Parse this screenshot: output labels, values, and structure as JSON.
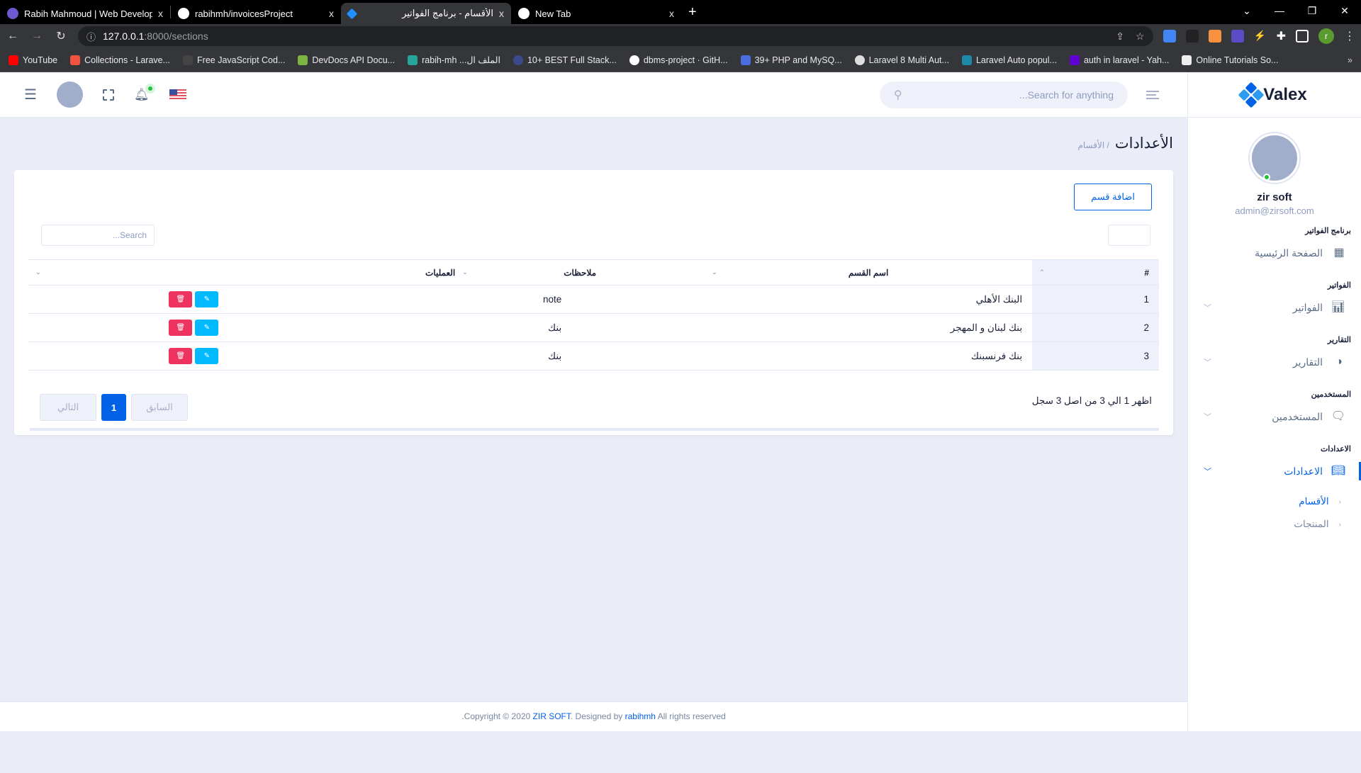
{
  "browser": {
    "tabs": [
      {
        "title": "Rabih Mahmoud | Web Develope",
        "icon": "portfolio-favicon",
        "color": "#6a5acd",
        "active": false
      },
      {
        "title": "rabihmh/invoicesProject",
        "icon": "github-icon",
        "color": "#ffffff",
        "active": false
      },
      {
        "title": "الأقسام - برنامج الفواتير",
        "icon": "valex-favicon",
        "color": "#1e90ff",
        "active": true
      },
      {
        "title": "New Tab",
        "icon": "chrome-icon",
        "color": "#ffffff",
        "active": false
      }
    ],
    "close_glyph": "x",
    "new_tab_glyph": "+",
    "window_controls": {
      "tabsearch": "⌄",
      "minimize": "—",
      "maximize": "❐",
      "close": "✕"
    },
    "url": {
      "host": "127.0.0.1",
      "path": ":8000/sections"
    },
    "profile_initial": "r",
    "bookmarks": [
      {
        "label": "YouTube",
        "color": "#ff0000"
      },
      {
        "label": "Collections - Larave...",
        "color": "#f05340"
      },
      {
        "label": "Free JavaScript Cod...",
        "color": "#444444"
      },
      {
        "label": "DevDocs API Docu...",
        "color": "#7cb342"
      },
      {
        "label": "rabih-mh ...الملف ال",
        "color": "#26a69a"
      },
      {
        "label": "10+ BEST Full Stack...",
        "color": "#3b4a8c"
      },
      {
        "label": "dbms-project · GitH...",
        "color": "#ffffff"
      },
      {
        "label": "39+ PHP and MySQ...",
        "color": "#4a6ee0"
      },
      {
        "label": "Laravel 8 Multi Aut...",
        "color": "#dddddd"
      },
      {
        "label": "Laravel Auto popul...",
        "color": "#1e88a8"
      },
      {
        "label": "auth in laravel - Yah...",
        "color": "#6001d2"
      },
      {
        "label": "Online Tutorials So...",
        "color": "#eeeeee"
      }
    ],
    "bookmarks_more": "»"
  },
  "header": {
    "search_placeholder": "Search for anything...",
    "notification_dot_color": "#22c03c"
  },
  "sidebar": {
    "brand": "Valex",
    "user_name": "zir soft",
    "user_email": "admin@zirsoft.com",
    "sections": [
      {
        "category": "برنامج الفواتير",
        "item": "الصفحة الرئيسية",
        "icon": "dashboard-icon",
        "active": false,
        "has_chevron": false
      },
      {
        "category": "الفواتير",
        "item": "الفواتير",
        "icon": "bar-chart-icon",
        "active": false,
        "has_chevron": true
      },
      {
        "category": "التقارير",
        "item": "التقارير",
        "icon": "pie-chart-icon",
        "active": false,
        "has_chevron": true
      },
      {
        "category": "المستخدمين",
        "item": "المستخدمين",
        "icon": "chat-icon",
        "active": false,
        "has_chevron": true
      },
      {
        "category": "الاعدادات",
        "item": "الاعدادات",
        "icon": "book-icon",
        "active": true,
        "has_chevron": true
      }
    ],
    "sub_items": [
      {
        "label": "الأقسام",
        "active": true
      },
      {
        "label": "المنتجات",
        "active": false
      }
    ],
    "accent_color": "#0162e8"
  },
  "page": {
    "title": "الأعدادات",
    "breadcrumb_sub": "/ الأقسام",
    "add_button": "اضافة قسم",
    "table_search_placeholder": "Search...",
    "columns": [
      "#",
      "اسم القسم",
      "ملاحظات",
      "العمليات"
    ],
    "rows": [
      {
        "num": "1",
        "name": "البنك الأهلي",
        "notes": "note"
      },
      {
        "num": "2",
        "name": "بنك لبنان و المهجر",
        "notes": "بنك"
      },
      {
        "num": "3",
        "name": "بنك فرنسبنك",
        "notes": "بنك"
      }
    ],
    "info_text": "اظهر 1 الي 3 من اصل 3 سجل",
    "pagination": {
      "previous": "السابق",
      "current": "1",
      "next": "التالي"
    }
  },
  "footer": {
    "prefix": ".Copyright © 2020 ",
    "company": "ZIR SOFT",
    "middle": ". Designed by ",
    "author": "rabihmh",
    "suffix": " All rights reserved"
  }
}
